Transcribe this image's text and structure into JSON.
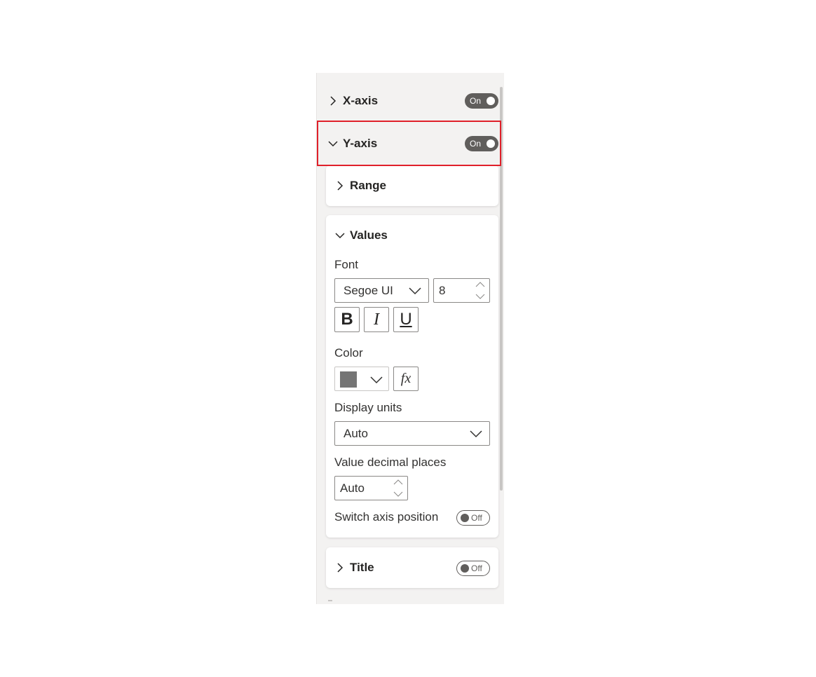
{
  "panel": {
    "sections": [
      {
        "id": "x-axis",
        "label": "X-axis",
        "expanded": false,
        "toggle": "On"
      },
      {
        "id": "y-axis",
        "label": "Y-axis",
        "expanded": true,
        "toggle": "On"
      }
    ],
    "y_axis": {
      "range": {
        "label": "Range",
        "expanded": false
      },
      "values": {
        "label": "Values",
        "expanded": true,
        "font_label": "Font",
        "font_family": "Segoe UI",
        "font_size": "8",
        "bold_label": "B",
        "italic_label": "I",
        "underline_label": "U",
        "color_label": "Color",
        "color_value": "#757575",
        "fx_label": "fx",
        "display_units_label": "Display units",
        "display_units_value": "Auto",
        "decimal_places_label": "Value decimal places",
        "decimal_places_value": "Auto",
        "switch_axis_label": "Switch axis position",
        "switch_axis_toggle": "Off"
      },
      "title": {
        "label": "Title",
        "expanded": false,
        "toggle": "Off"
      }
    }
  },
  "colors": {
    "highlight": "#e0202a",
    "toggle_on": "#605e5c",
    "panel_bg": "#f3f2f1"
  }
}
